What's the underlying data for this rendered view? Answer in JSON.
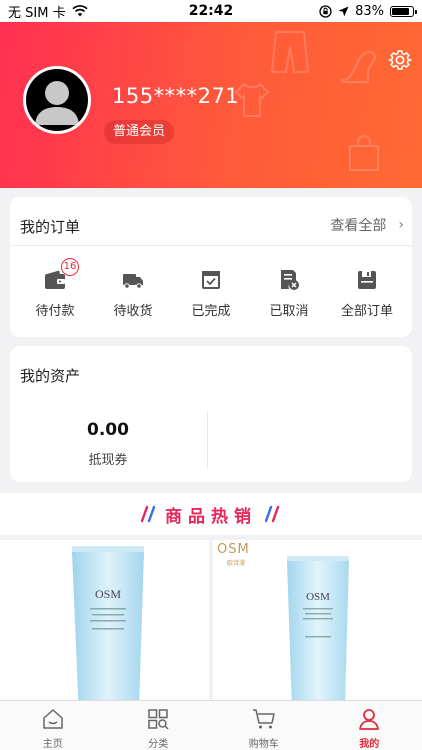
{
  "status_bar": {
    "carrier": "无 SIM 卡",
    "time": "22:42",
    "battery": "83%",
    "battery_level": 0.83
  },
  "profile": {
    "phone": "155****271",
    "member_level": "普通会员"
  },
  "orders": {
    "title": "我的订单",
    "view_all": "查看全部",
    "items": [
      {
        "label": "待付款",
        "badge": "16",
        "icon": "wallet-icon"
      },
      {
        "label": "待收货",
        "icon": "truck-icon"
      },
      {
        "label": "已完成",
        "icon": "check-box-icon"
      },
      {
        "label": "已取消",
        "icon": "cancel-doc-icon"
      },
      {
        "label": "全部订单",
        "icon": "save-doc-icon"
      }
    ]
  },
  "assets": {
    "title": "我的资产",
    "coupon_value": "0.00",
    "coupon_label": "抵现券"
  },
  "hot_sales": {
    "title": "商品热销"
  },
  "products": {
    "brand": "OSM",
    "brand_sub": "欧诗漫"
  },
  "tabbar": {
    "items": [
      {
        "label": "主页",
        "icon": "home-icon"
      },
      {
        "label": "分类",
        "icon": "category-icon"
      },
      {
        "label": "购物车",
        "icon": "cart-icon"
      },
      {
        "label": "我的",
        "icon": "user-icon"
      }
    ],
    "active_index": 3
  },
  "colors": {
    "accent": "#e62b3a",
    "header_start": "#ff2f52",
    "header_end": "#ff6a33",
    "hot_title": "#e8265a"
  }
}
